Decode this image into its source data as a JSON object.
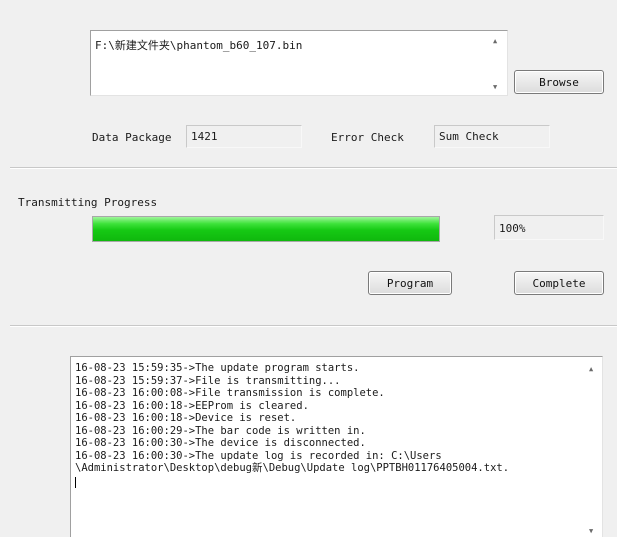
{
  "file": {
    "path": "F:\\新建文件夹\\phantom_b60_107.bin",
    "browse_label": "Browse"
  },
  "package": {
    "data_label": "Data Package",
    "data_value": "1421",
    "error_label": "Error Check",
    "error_value": "Sum Check"
  },
  "progress": {
    "label": "Transmitting Progress",
    "percent_text": "100%",
    "fraction": 1.0,
    "fill_color": "#16c914"
  },
  "buttons": {
    "program_label": "Program",
    "complete_label": "Complete"
  },
  "log": {
    "lines": [
      "16-08-23 15:59:35->The update program starts.",
      "16-08-23 15:59:37->File is transmitting...",
      "16-08-23 16:00:08->File transmission is complete.",
      "16-08-23 16:00:18->EEProm is cleared.",
      "16-08-23 16:00:18->Device is reset.",
      "16-08-23 16:00:29->The bar code is written in.",
      "16-08-23 16:00:30->The device is disconnected.",
      "16-08-23 16:00:30->The update log is recorded in: C:\\Users",
      "\\Administrator\\Desktop\\debug新\\Debug\\Update log\\PPTBH01176405004.txt."
    ]
  },
  "icons": {
    "scroll_up": "▲",
    "scroll_down": "▼"
  }
}
